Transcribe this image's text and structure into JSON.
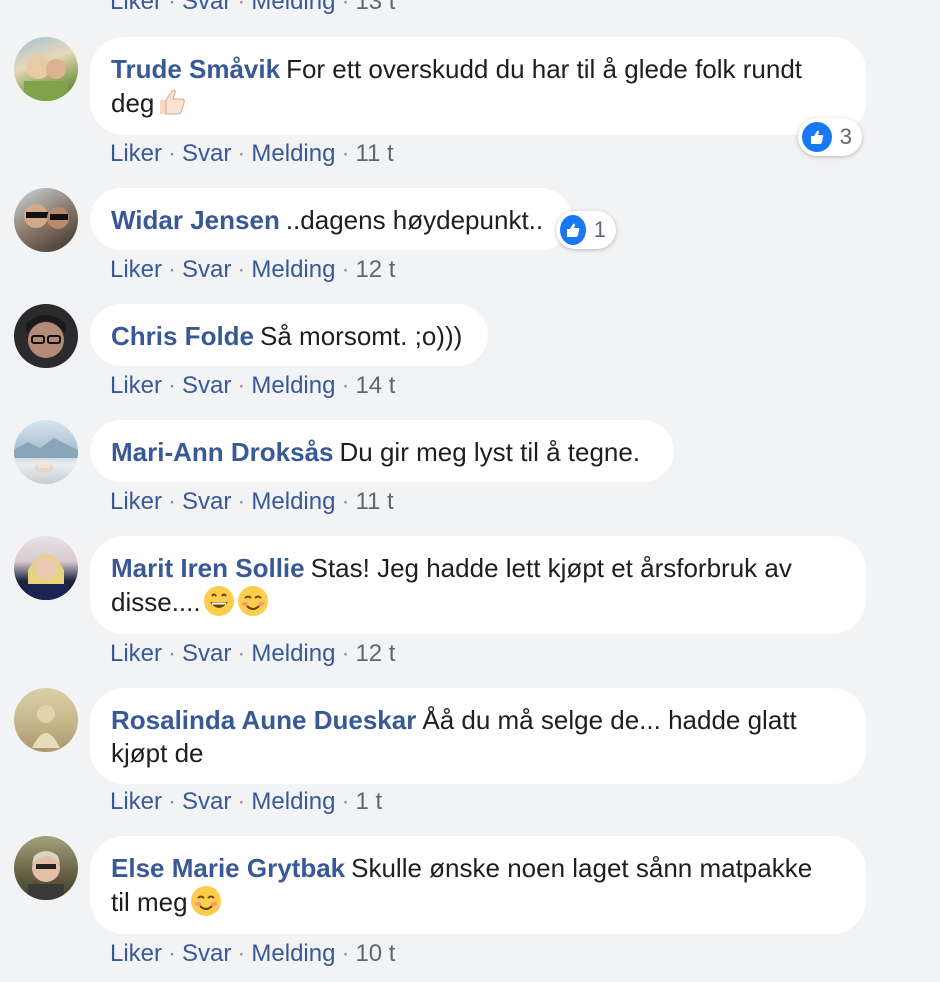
{
  "cutoff": {
    "like": "Liker",
    "reply": "Svar",
    "message": "Melding",
    "time": "13 t"
  },
  "actions_labels": {
    "like": "Liker",
    "reply": "Svar",
    "message": "Melding"
  },
  "comments": [
    {
      "author": "Trude Småvik",
      "text_line1": "For ett overskudd du har til å glede folk rundt",
      "text_line2": "deg",
      "reaction_count": "3",
      "time": "11 t"
    },
    {
      "author": "Widar Jensen",
      "text": "..dagens høydepunkt..",
      "reaction_count": "1",
      "time": "12 t"
    },
    {
      "author": "Chris Folde",
      "text": "Så morsomt. ;o)))",
      "time": "14 t"
    },
    {
      "author": "Mari-Ann Droksås",
      "text": "Du gir meg lyst til å tegne.",
      "time": "11 t"
    },
    {
      "author": "Marit Iren Sollie",
      "text_line1": "Stas! Jeg hadde lett kjøpt et årsforbruk av",
      "text_line2": "disse....",
      "time": "12 t"
    },
    {
      "author": "Rosalinda Aune Dueskar",
      "text_line1": "Åå du må selge de... hadde glatt",
      "text_line2": "kjøpt de",
      "time": "1 t"
    },
    {
      "author": "Else Marie Grytbak",
      "text_line1": "Skulle ønske noen laget sånn matpakke",
      "text_line2": "til meg",
      "time": "10 t"
    }
  ]
}
